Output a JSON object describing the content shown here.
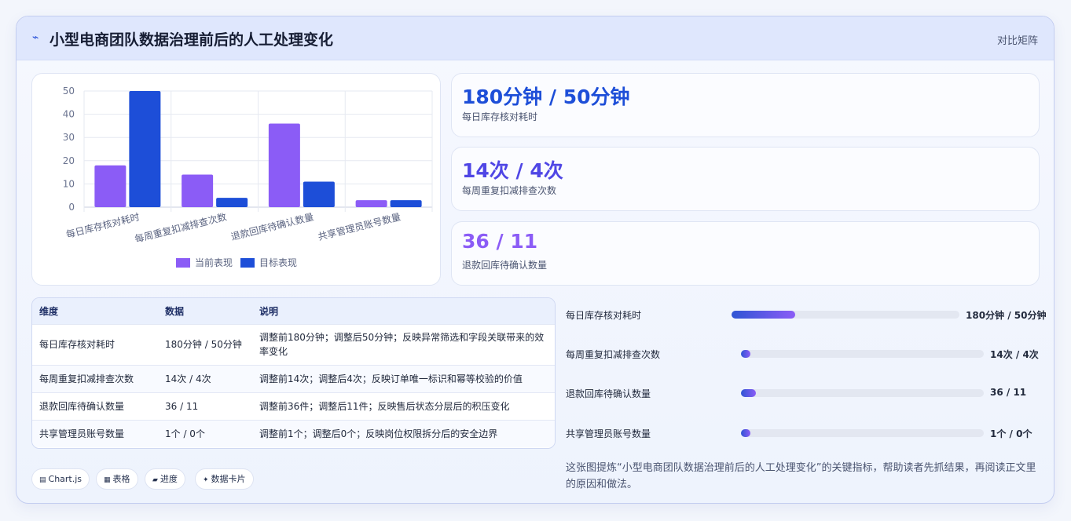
{
  "header": {
    "title": "小型电商团队数据治理前后的人工处理变化",
    "tag": "对比矩阵"
  },
  "colors": {
    "series_current": "#8b5cf6",
    "series_target": "#1d4ed8",
    "kpi_1": "#1d4ed8",
    "kpi_2": "#4f46e5",
    "kpi_3": "#8b5cf6"
  },
  "chart_data": {
    "type": "bar",
    "categories": [
      "每日库存核对耗时",
      "每周重复扣减排查次数",
      "退款回库待确认数量",
      "共享管理员账号数量"
    ],
    "series": [
      {
        "name": "当前表现",
        "values": [
          18,
          14,
          36,
          3
        ]
      },
      {
        "name": "目标表现",
        "values": [
          50,
          4,
          11,
          3
        ]
      }
    ],
    "ylim": [
      0,
      50
    ],
    "yticks": [
      0,
      10,
      20,
      30,
      40,
      50
    ],
    "grid": true,
    "legend": "bottom"
  },
  "kpis": [
    {
      "value": "180分钟 / 50分钟",
      "label": "每日库存核对耗时"
    },
    {
      "value": "14次 / 4次",
      "label": "每周重复扣减排查次数"
    },
    {
      "value": "36 / 11",
      "label": "退款回库待确认数量"
    }
  ],
  "table": {
    "headers": [
      "维度",
      "数据",
      "说明"
    ],
    "rows": [
      {
        "dim": "每日库存核对耗时",
        "data": "180分钟 / 50分钟",
        "desc": "调整前180分钟；调整后50分钟；反映异常筛选和字段关联带来的效率变化"
      },
      {
        "dim": "每周重复扣减排查次数",
        "data": "14次 / 4次",
        "desc": "调整前14次；调整后4次；反映订单唯一标识和幂等校验的价值"
      },
      {
        "dim": "退款回库待确认数量",
        "data": "36 / 11",
        "desc": "调整前36件；调整后11件；反映售后状态分层后的积压变化"
      },
      {
        "dim": "共享管理员账号数量",
        "data": "1个 / 0个",
        "desc": "调整前1个；调整后0个；反映岗位权限拆分后的安全边界"
      }
    ]
  },
  "pills": [
    {
      "icon": "▤",
      "label": "Chart.js"
    },
    {
      "icon": "▦",
      "label": "表格"
    },
    {
      "icon": "▰",
      "label": "进度"
    },
    {
      "icon": "✦",
      "label": "数据卡片"
    }
  ],
  "progress": [
    {
      "label": "每日库存核对耗时",
      "value_text": "180分钟 / 50分钟",
      "fraction": 0.28
    },
    {
      "label": "每周重复扣减排查次数",
      "value_text": "14次 / 4次",
      "fraction": 0.04
    },
    {
      "label": "退款回库待确认数量",
      "value_text": "36 / 11",
      "fraction": 0.06
    },
    {
      "label": "共享管理员账号数量",
      "value_text": "1个 / 0个",
      "fraction": 0.04
    }
  ],
  "note": "这张图提炼“小型电商团队数据治理前后的人工处理变化”的关键指标，帮助读者先抓结果，再阅读正文里的原因和做法。"
}
